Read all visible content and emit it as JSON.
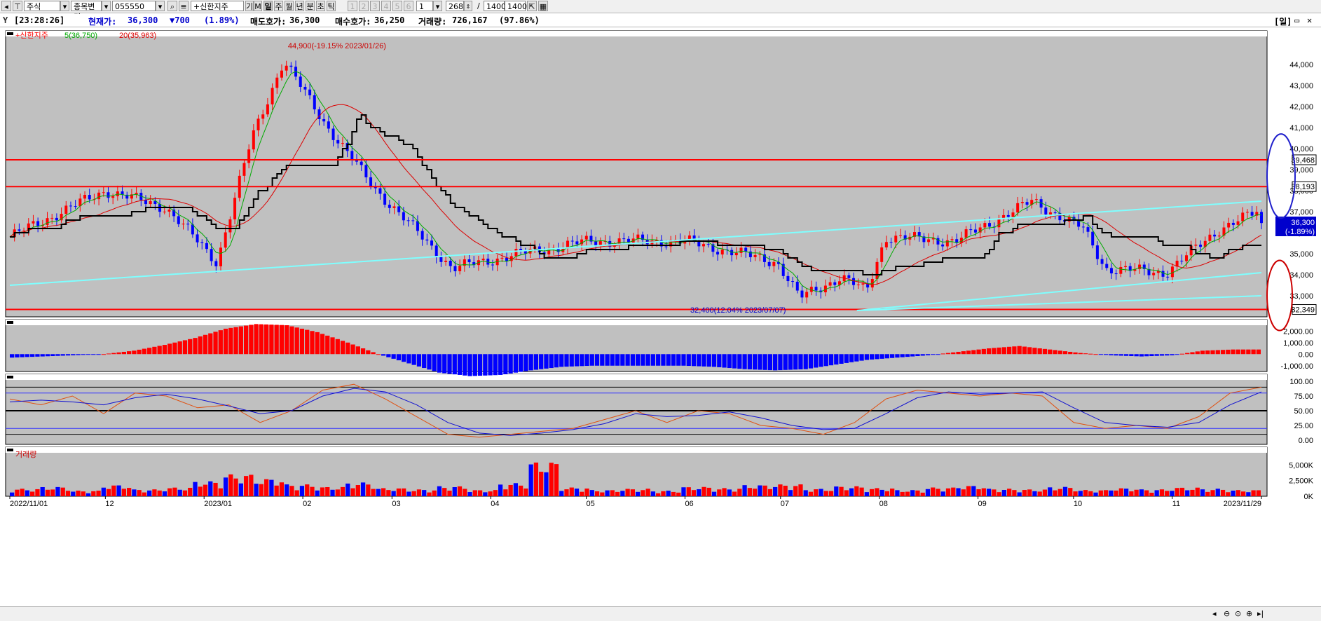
{
  "toolbar": {
    "market_select": "주식",
    "change_select": "종목변경",
    "code_input": "055550",
    "name_input": "+신한지주",
    "modes": [
      "기",
      "M",
      "일",
      "주",
      "월",
      "년",
      "분",
      "초",
      "틱"
    ],
    "active_mode": "일",
    "page_buttons": [
      "1",
      "2",
      "3",
      "4",
      "5",
      "6"
    ],
    "period_select": "1",
    "count": "268",
    "slash": "/",
    "total_a": "1400",
    "total_b": "1400"
  },
  "info": {
    "time": "[23:28:26]",
    "price_label": "현재가:",
    "price": "36,300",
    "change": "▼700",
    "change_pct": "(1.89%)",
    "ask_label": "매도호가:",
    "ask": "36,300",
    "bid_label": "매수호가:",
    "bid": "36,250",
    "vol_label": "거래량:",
    "volume": "726,167",
    "vol_pct": "(97.86%)",
    "period_tag": "[일]"
  },
  "colors": {
    "background": "#c0c0c0",
    "up": "#ff0000",
    "down": "#0000ff",
    "ma5": "#00aa00",
    "ma20": "#dd0000",
    "trendline": "#7fffff",
    "signal_line": "#6ad0d0",
    "stoch_k": "#e05010",
    "stoch_d": "#1010d0"
  },
  "chart_data": [
    {
      "type": "candlestick",
      "title": "+신한지주",
      "legend": [
        {
          "name": "5(36,750)",
          "color": "#00aa00"
        },
        {
          "name": "20(35,963)",
          "color": "#dd0000"
        }
      ],
      "ylim": [
        32000,
        45200
      ],
      "y_ticks": [
        33000,
        34000,
        35000,
        36000,
        37000,
        38000,
        39000,
        40000,
        41000,
        42000,
        43000,
        44000
      ],
      "y_tick_labels": [
        "33,000",
        "34,000",
        "35,000",
        "36,000",
        "37,000",
        "38,000",
        "39,000",
        "40,000",
        "41,000",
        "42,000",
        "43,000",
        "44,000"
      ],
      "x_tick_labels": [
        "2022/11/01",
        "12",
        "2023/01",
        "02",
        "03",
        "04",
        "05",
        "06",
        "07",
        "08",
        "09",
        "10",
        "11",
        "2023/11/29"
      ],
      "key_points": [
        {
          "date": "2022-11-01",
          "close": 35800
        },
        {
          "date": "2022-12-01",
          "close": 38000
        },
        {
          "date": "2022-12-20",
          "close": 37200
        },
        {
          "date": "2023-01-02",
          "close": 35100
        },
        {
          "date": "2023-01-05",
          "close": 34600
        },
        {
          "date": "2023-01-16",
          "close": 40500
        },
        {
          "date": "2023-01-26",
          "close": 44200
        },
        {
          "date": "2023-02-07",
          "close": 41400
        },
        {
          "date": "2023-02-23",
          "close": 38200
        },
        {
          "date": "2023-03-20",
          "close": 34300
        },
        {
          "date": "2023-04-10",
          "close": 35000
        },
        {
          "date": "2023-05-02",
          "close": 35600
        },
        {
          "date": "2023-06-01",
          "close": 35600
        },
        {
          "date": "2023-06-30",
          "close": 34600
        },
        {
          "date": "2023-07-07",
          "close": 32900
        },
        {
          "date": "2023-07-20",
          "close": 33900
        },
        {
          "date": "2023-07-28",
          "close": 33200
        },
        {
          "date": "2023-08-03",
          "close": 35800
        },
        {
          "date": "2023-08-25",
          "close": 35600
        },
        {
          "date": "2023-09-18",
          "close": 37500
        },
        {
          "date": "2023-10-04",
          "close": 36200
        },
        {
          "date": "2023-10-11",
          "close": 34300
        },
        {
          "date": "2023-10-30",
          "close": 34100
        },
        {
          "date": "2023-11-16",
          "close": 36200
        },
        {
          "date": "2023-11-28",
          "close": 37000
        },
        {
          "date": "2023-11-29",
          "close": 36300
        }
      ],
      "horizontal_lines": [
        39468,
        38193,
        32349
      ],
      "price_tags": [
        "39,468",
        "38,193",
        "32,349"
      ],
      "current_tag": [
        "36,300",
        "(-1.89%)"
      ],
      "current_price": 36300,
      "high_annotation": {
        "text": "44,900(-19.15% 2023/01/26)",
        "value": 44900
      },
      "low_annotation": {
        "text": "32,400(12.04% 2023/07/07)",
        "value": 32400
      },
      "trend_channel": [
        {
          "from_date": "2022-11-01",
          "from": 33500,
          "to_date": "2023-11-29",
          "to": 37500
        },
        {
          "from_date": "2023-07-25",
          "from": 32300,
          "to_date": "2023-11-29",
          "to": 34100
        },
        {
          "from_date": "2023-07-25",
          "from": 32300,
          "to_date": "2023-11-29",
          "to": 33000
        }
      ],
      "annotation_circles": [
        "blue around 38,193-39,468 tags",
        "red around 32,349 tag"
      ]
    },
    {
      "type": "bar",
      "name": "MACD oscillator",
      "ylim": [
        -1500,
        2500
      ],
      "y_tick_labels": [
        "2,000.00",
        "1,000.00",
        "0.00",
        "-1,000.00"
      ],
      "values": [
        -300,
        -200,
        -100,
        0,
        300,
        800,
        1400,
        2200,
        2600,
        2500,
        1900,
        1000,
        0,
        -800,
        -1600,
        -1900,
        -1800,
        -1400,
        -1100,
        -1000,
        -1000,
        -1000,
        -1000,
        -1100,
        -1300,
        -1400,
        -1300,
        -900,
        -500,
        -300,
        -100,
        200,
        500,
        700,
        400,
        100,
        -100,
        -200,
        -100,
        300,
        400
      ]
    },
    {
      "type": "line",
      "name": "Stochastic",
      "ylim": [
        0,
        100
      ],
      "y_tick_labels": [
        "100.00",
        "75.00",
        "50.00",
        "25.00",
        "0.00"
      ],
      "series": [
        {
          "name": "%K",
          "values": [
            70,
            60,
            75,
            45,
            80,
            75,
            55,
            60,
            30,
            50,
            85,
            95,
            70,
            40,
            10,
            5,
            10,
            15,
            20,
            35,
            50,
            30,
            50,
            45,
            25,
            20,
            10,
            30,
            70,
            85,
            80,
            75,
            80,
            75,
            30,
            20,
            25,
            20,
            40,
            80,
            90
          ]
        },
        {
          "name": "%D",
          "values": [
            65,
            68,
            65,
            60,
            72,
            78,
            70,
            58,
            45,
            50,
            75,
            88,
            82,
            60,
            30,
            12,
            8,
            12,
            18,
            28,
            45,
            40,
            42,
            48,
            38,
            25,
            18,
            20,
            45,
            72,
            82,
            78,
            80,
            82,
            55,
            30,
            25,
            22,
            30,
            60,
            82
          ]
        }
      ],
      "reference_lines": [
        90,
        80,
        50,
        20,
        10
      ]
    },
    {
      "type": "bar",
      "title": "거래량",
      "ylim": [
        0,
        6500
      ],
      "y_tick_labels": [
        "5,000K",
        "2,500K",
        "0K"
      ],
      "values": [
        1200,
        1500,
        900,
        1800,
        1100,
        1400,
        2400,
        3500,
        2800,
        1900,
        1500,
        2200,
        1300,
        1100,
        1600,
        1000,
        2100,
        5500,
        1400,
        1000,
        1200,
        900,
        1500,
        1300,
        1800,
        1900,
        1200,
        1600,
        1300,
        1000,
        1400,
        1700,
        1200,
        1100,
        1500,
        1000,
        1300,
        1100,
        1400,
        1200,
        1000
      ]
    }
  ]
}
